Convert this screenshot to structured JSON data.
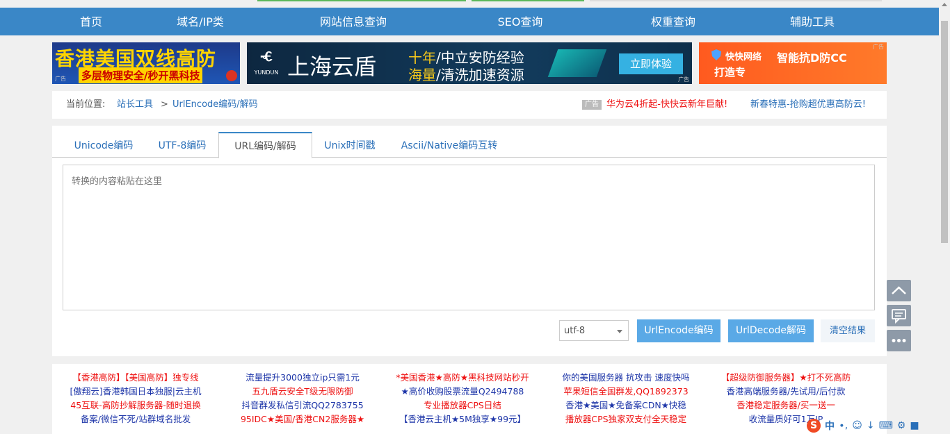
{
  "nav": {
    "items": [
      "首页",
      "域名/IP类",
      "网站信息查询",
      "SEO查询",
      "权重查询",
      "辅助工具"
    ]
  },
  "ads": {
    "ad1": {
      "title": "香港美国双线高防",
      "subtitle": "多层物理安全/秒开黑科技",
      "tag": "广告"
    },
    "ad2": {
      "logo": "YUNDUN",
      "name": "上海云盾",
      "line1a": "十年",
      "line1b": "/中立安防经验",
      "line2a": "海量",
      "line2b": "/清洗加速资源",
      "button": "立即体验",
      "tag": "广告"
    },
    "ad3": {
      "brand": "快快网络",
      "title": "智能抗D防CC",
      "subtitle": "打造专",
      "tag": "广告"
    }
  },
  "breadcrumb": {
    "label": "当前位置:",
    "link1": "站长工具",
    "sep": ">",
    "link2": "UrlEncode编码/解码",
    "ad_badge": "广告",
    "ad_link1": "华为云4折起-快快云新年巨献!",
    "ad_link2": "新春特惠-抢购超优惠高防云!"
  },
  "tabs": [
    "Unicode编码",
    "UTF-8编码",
    "URL编码/解码",
    "Unix时间戳",
    "Ascii/Native编码互转"
  ],
  "editor": {
    "placeholder": "转换的内容粘贴在这里"
  },
  "controls": {
    "charset": "utf-8",
    "encode_button": "UrlEncode编码",
    "decode_button": "UrlDecode解码",
    "clear_button": "清空结果"
  },
  "footer_links": [
    [
      "【香港高防】【美国高防】独专线",
      "[傲翔云]香港韩国日本独服|云主机",
      "45互联-高防抄解服务器-随时退换",
      "备案/微信不死/站群域名批发"
    ],
    [
      "流量提升3000独立ip只需1元",
      "五九盾云安全T级无限防御",
      "抖音群发私信引流QQ2783755",
      "95IDC★美国/香港CN2服务器★"
    ],
    [
      "*美国香港★高防★黑科技网站秒开",
      "★高价收购股票流量Q2494788",
      "专业播放器CPS日结",
      "【香港云主机★5M独享★99元】"
    ],
    [
      "你的美国服务器 抗攻击 速度快吗",
      "苹果短信全国群发,QQ1892373",
      "香港★美国★免备案CDN★快稳",
      "播放器CPS独家双支付全天稳定"
    ],
    [
      "【超级防御服务器】★打不死高防",
      "香港高端服务器/先试用/后付款",
      "香港稳定服务器/买一送一",
      "收流量质好可1万IP"
    ]
  ],
  "footer_colors": [
    [
      "red",
      "blue",
      "red",
      "blue"
    ],
    [
      "blue",
      "red",
      "blue",
      "red"
    ],
    [
      "red",
      "blue",
      "red",
      "blue"
    ],
    [
      "blue",
      "red",
      "blue",
      "red"
    ],
    [
      "red",
      "blue",
      "red",
      "blue"
    ]
  ],
  "ime": {
    "logo": "S",
    "lang": "中"
  }
}
